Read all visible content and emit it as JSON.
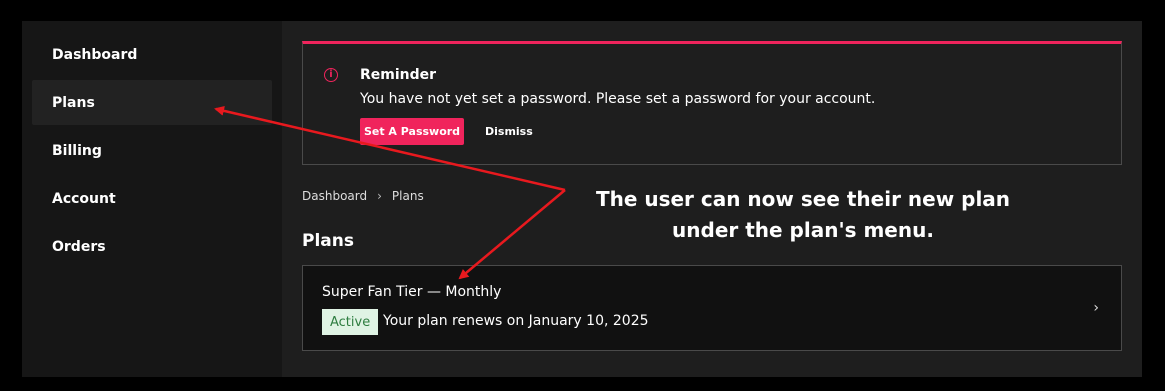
{
  "sidebar": {
    "items": [
      {
        "label": "Dashboard"
      },
      {
        "label": "Plans",
        "active": true
      },
      {
        "label": "Billing"
      },
      {
        "label": "Account"
      },
      {
        "label": "Orders"
      }
    ]
  },
  "reminder": {
    "icon": "info-icon",
    "title": "Reminder",
    "message": "You have not yet set a password. Please set a password for your account.",
    "primary_button": "Set A Password",
    "dismiss_button": "Dismiss"
  },
  "breadcrumb": {
    "items": [
      "Dashboard",
      "Plans"
    ]
  },
  "page": {
    "title": "Plans"
  },
  "plan": {
    "name": "Super Fan Tier — Monthly",
    "status": "Active",
    "renewal": "Your plan renews on January 10, 2025"
  },
  "annotation": {
    "line1": "The user can now see their new plan",
    "line2": "under the plan's menu."
  },
  "colors": {
    "accent": "#f0245c",
    "status_bg": "#dff3e4",
    "status_text": "#2e7d40",
    "arrow": "#e8191e"
  }
}
